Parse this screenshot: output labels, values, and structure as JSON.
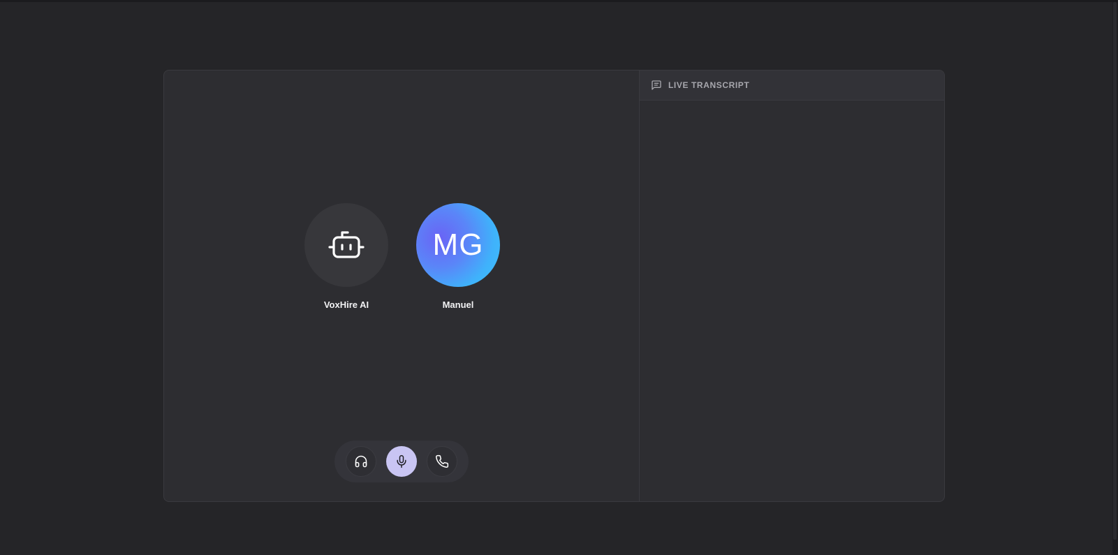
{
  "participants": [
    {
      "name": "VoxHire AI",
      "avatar": "robot-icon"
    },
    {
      "name": "Manuel",
      "initials": "MG"
    }
  ],
  "controls": [
    {
      "icon": "headphones-icon"
    },
    {
      "icon": "microphone-icon",
      "active": true
    },
    {
      "icon": "phone-icon"
    }
  ],
  "transcript": {
    "title": "LIVE TRANSCRIPT",
    "icon": "chat-icon",
    "lines": []
  },
  "colors": {
    "background": "#252528",
    "card": "#2d2d31",
    "active_control": "#c9c5f3",
    "avatar_gradient_start": "#6a63f5",
    "avatar_gradient_end": "#3ec3fd"
  }
}
